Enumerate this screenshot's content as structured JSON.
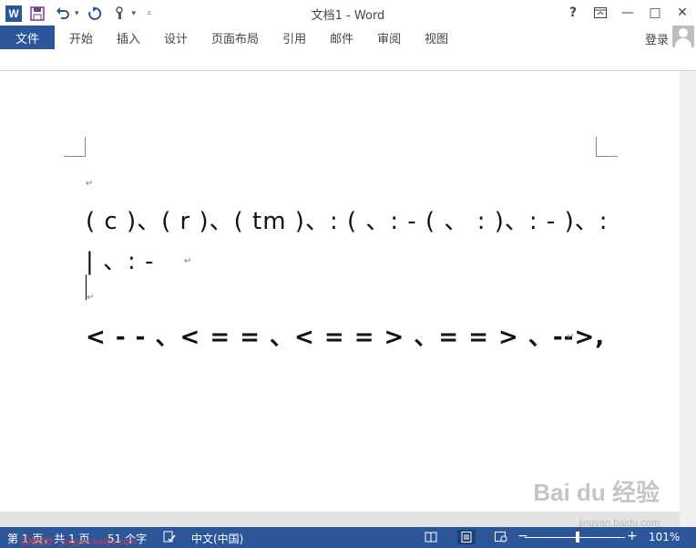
{
  "window": {
    "title": "文档1 - Word",
    "help": "?",
    "restore_icon": "ribbon-display-icon",
    "minimize": "—",
    "maximize": "□",
    "close": "✕"
  },
  "qat": {
    "logo": "W",
    "save_icon": "save-icon",
    "undo_icon": "undo-icon",
    "redo_icon": "redo-icon",
    "touch_icon": "touch-mode-icon",
    "customize_icon": "customize-qat-icon"
  },
  "ribbon": {
    "file_tab": "文件",
    "tabs": [
      "开始",
      "插入",
      "设计",
      "页面布局",
      "引用",
      "邮件",
      "审阅",
      "视图"
    ],
    "sign_in": "登录"
  },
  "document": {
    "line1": "( c )、( r )、( tm )、: (  、: - (  、  : )、: - )、:",
    "line2": " |  、: -",
    "line3": "< - -  、< = =  、< = = >  、= = >  、-->,",
    "para_mark": "↵"
  },
  "statusbar": {
    "page": "第 1 页，共 1 页",
    "words": "51 个字",
    "language": "中文(中国)",
    "zoom": "101%",
    "zoom_minus": "−",
    "zoom_plus": "+",
    "overlay_text": "百度经验 · jingyan.baidu.com"
  },
  "watermark": {
    "main": "Bai du 经验",
    "sub": "jingyan.baidu.com"
  },
  "colors": {
    "accent": "#2b579a"
  }
}
